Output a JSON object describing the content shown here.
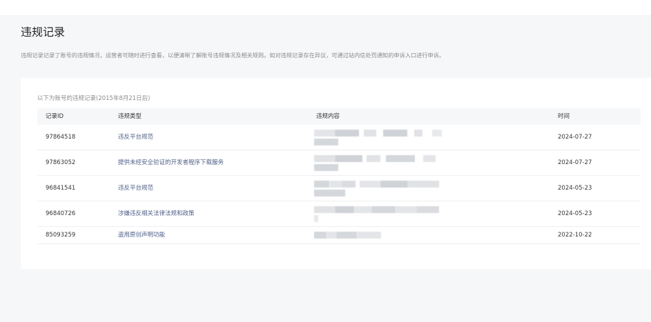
{
  "page": {
    "title": "违规记录",
    "description": "违规记录记录了账号的违规情况，运营者可随时进行查看，以便清晰了解账号违规情况及相关规则。如对违规记录存在异议，可通过站内信处罚通知的申诉入口进行申诉。"
  },
  "records": {
    "caption": "以下为账号的违规记录(2015年8月21日后)",
    "columns": [
      "记录ID",
      "违规类型",
      "违规内容",
      "时间"
    ],
    "rows": [
      {
        "id": "97864518",
        "type": "违反平台规范",
        "time": "2024-07-27"
      },
      {
        "id": "97863052",
        "type": "提供未经安全验证的开发者程序下载服务",
        "time": "2024-07-27"
      },
      {
        "id": "96841541",
        "type": "违反平台规范",
        "time": "2024-05-23"
      },
      {
        "id": "96840726",
        "type": "涉嫌违反相关法律法规和政策",
        "time": "2024-05-23"
      },
      {
        "id": "85093259",
        "type": "盗用原创声明功能",
        "time": "2022-10-22"
      }
    ]
  },
  "colors": {
    "bg": "#f6f7f9",
    "card": "#ffffff",
    "thead": "#f6f7f9",
    "text": "#353535",
    "muted": "#8a8a8a",
    "type": "#4f6088",
    "divider": "#eeeff1"
  }
}
